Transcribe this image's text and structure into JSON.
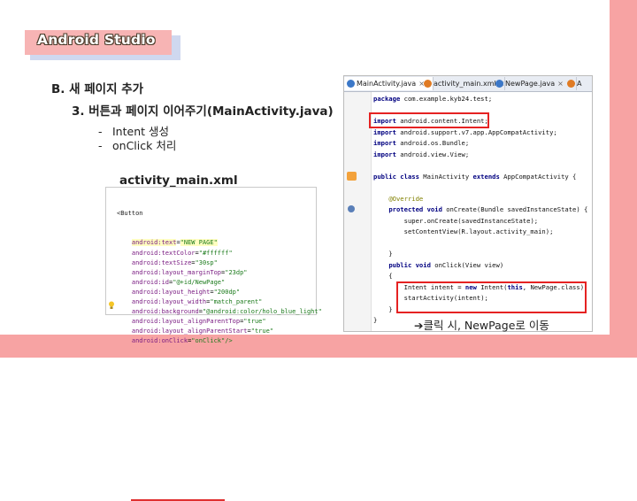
{
  "title": "Android Studio",
  "heading_b": "B. 새 페이지 추가",
  "heading_3": "3. 버튼과 페이지 이어주기(MainActivity.java)",
  "bullets": [
    "Intent 생성",
    "onClick 처리"
  ],
  "bullet_marker": "-",
  "xml_title": "activity_main.xml",
  "xml": {
    "start_tag": "<Button",
    "attrs": [
      {
        "key": "android:text",
        "value": "\"NEW PAGE\""
      },
      {
        "key": "android:textColor",
        "value": "\"#ffffff\""
      },
      {
        "key": "android:textSize",
        "value": "\"30sp\""
      },
      {
        "key": "android:layout_marginTop",
        "value": "\"23dp\""
      },
      {
        "key": "android:id",
        "value": "\"@+id/NewPage\""
      },
      {
        "key": "android:layout_height",
        "value": "\"200dp\""
      },
      {
        "key": "android:layout_width",
        "value": "\"match_parent\""
      },
      {
        "key": "android:background",
        "value": "\"@android:color/holo_blue_light\""
      },
      {
        "key": "android:layout_alignParentTop",
        "value": "\"true\""
      },
      {
        "key": "android:layout_alignParentStart",
        "value": "\"true\""
      },
      {
        "key": "android:onClick",
        "value": "\"onClick\"/>"
      }
    ]
  },
  "ide": {
    "tabs": [
      {
        "label": "MainActivity.java",
        "icon_color": "#3c78c8",
        "active": true
      },
      {
        "label": "activity_main.xml",
        "icon_color": "#e07b24",
        "active": false
      },
      {
        "label": "NewPage.java",
        "icon_color": "#3c78c8",
        "active": false
      },
      {
        "label": "A",
        "icon_color": "#e07b24",
        "active": false
      }
    ],
    "close_glyph": "×",
    "code": [
      "package com.example.kyb24.test;",
      "",
      "import android.content.Intent;",
      "import android.support.v7.app.AppCompatActivity;",
      "import android.os.Bundle;",
      "import android.view.View;",
      "",
      "public class MainActivity extends AppCompatActivity {",
      "",
      "    @Override",
      "    protected void onCreate(Bundle savedInstanceState) {",
      "        super.onCreate(savedInstanceState);",
      "        setContentView(R.layout.activity_main);",
      "",
      "    }",
      "    public void onClick(View view)",
      "    {",
      "        Intent intent = new Intent(this, NewPage.class);",
      "        startActivity(intent);",
      "    }",
      "}"
    ]
  },
  "caption": "➔클릭 시, NewPage로 이동",
  "colors": {
    "accent": "#f7a3a3",
    "highlight_box": "#e52222"
  }
}
